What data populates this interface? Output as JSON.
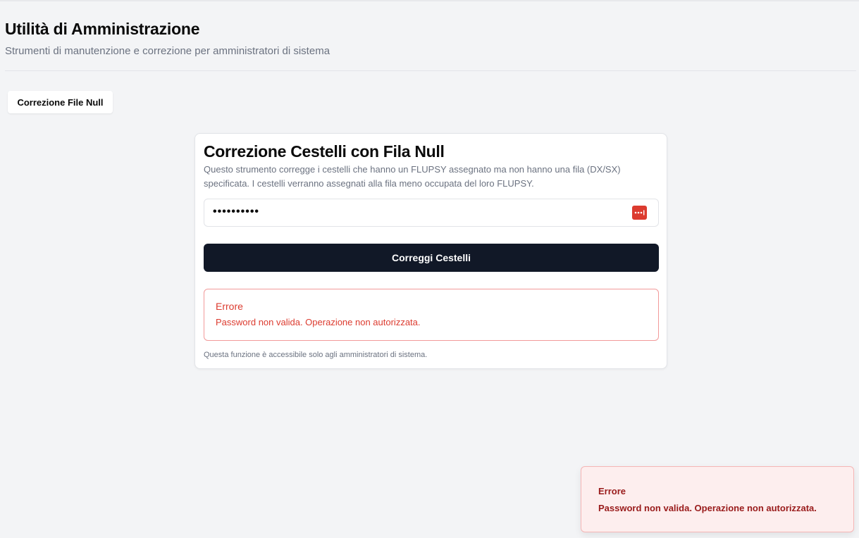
{
  "header": {
    "title": "Utilità di Amministrazione",
    "subtitle": "Strumenti di manutenzione e correzione per amministratori di sistema"
  },
  "tabs": [
    {
      "label": "Correzione File Null"
    }
  ],
  "card": {
    "title": "Correzione Cestelli con Fila Null",
    "description": "Questo strumento corregge i cestelli che hanno un FLUPSY assegnato ma non hanno una fila (DX/SX) specificata. I cestelli verranno assegnati alla fila meno occupata del loro FLUPSY.",
    "password": {
      "value": "••••••••••",
      "manager_icon": "password-manager-icon"
    },
    "submit_label": "Correggi Cestelli",
    "error": {
      "title": "Errore",
      "message": "Password non valida. Operazione non autorizzata."
    },
    "footnote": "Questa funzione è accessibile solo agli amministratori di sistema."
  },
  "toast": {
    "title": "Errore",
    "message": "Password non valida. Operazione non autorizzata."
  },
  "colors": {
    "background": "#f3f4f6",
    "primary_button": "#111827",
    "error": "#dc3b2f",
    "toast_text": "#991b1b",
    "toast_background": "#fdeeee"
  }
}
